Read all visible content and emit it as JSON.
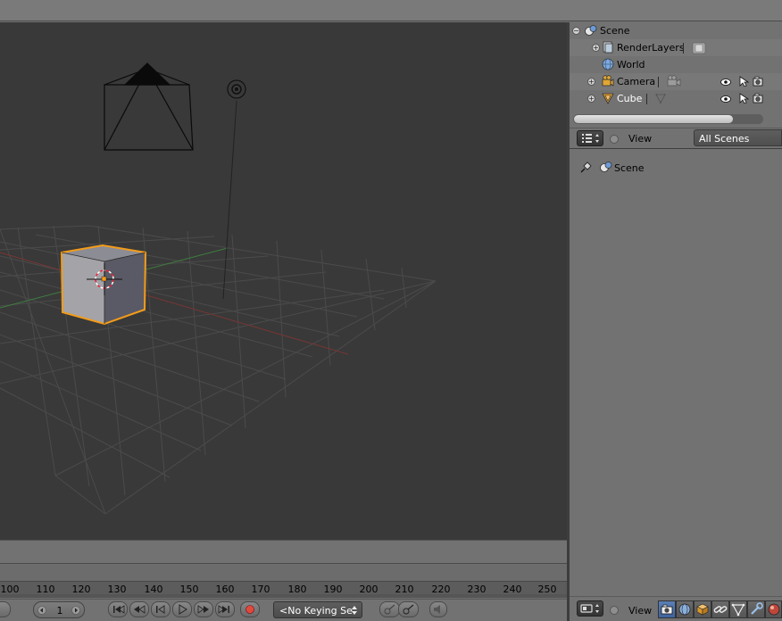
{
  "outliner": {
    "rows": [
      {
        "label": "Scene",
        "icon": "scene-icon"
      },
      {
        "label": "RenderLayers",
        "icon": "renderlayers-icon"
      },
      {
        "label": "World",
        "icon": "world-icon"
      },
      {
        "label": "Camera",
        "icon": "camera-icon"
      },
      {
        "label": "Cube",
        "icon": "mesh-icon"
      }
    ],
    "header": {
      "view_label": "View",
      "display_mode": "All Scenes"
    }
  },
  "properties": {
    "pinned_label": "Scene",
    "header": {
      "view_label": "View",
      "context_tabs": [
        "render-icon",
        "render-layers-icon",
        "scene-icon",
        "world-icon",
        "object-icon",
        "constraints-icon",
        "modifiers-icon",
        "data-icon",
        "material-icon"
      ]
    }
  },
  "timeline": {
    "ruler_labels": [
      "100",
      "110",
      "120",
      "130",
      "140",
      "150",
      "160",
      "170",
      "180",
      "190",
      "200",
      "210",
      "220",
      "230",
      "240",
      "250"
    ],
    "current_frame": "1",
    "keying_set": "<No Keying Se",
    "transport_icons": [
      "jump-start-icon",
      "prev-keyframe-icon",
      "play-reverse-icon",
      "play-icon",
      "next-keyframe-icon",
      "jump-end-icon"
    ],
    "record_icon": "record-icon"
  },
  "colors": {
    "viewport_bg": "#393939",
    "panel_bg": "#727272",
    "selection_orange": "#f39c1a",
    "x_axis_red": "#8a3a3a",
    "y_axis_green": "#3f8a3f",
    "active_tab_blue": "#4a70ab"
  }
}
